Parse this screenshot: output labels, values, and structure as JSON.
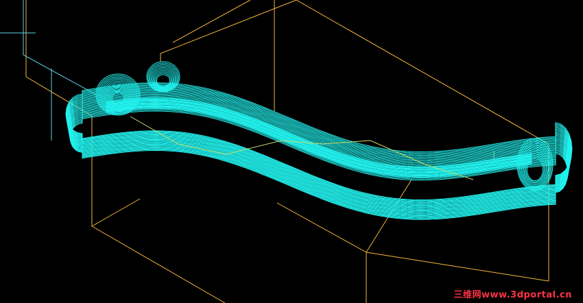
{
  "viewport": {
    "background": "#000000",
    "stock_box_color": "#f5b83c",
    "toolpath_color": "#22f2ee",
    "tool_axis_color": "#5fd6e6",
    "surface_color": "#c9e06a"
  },
  "watermark": {
    "text": "三维网www.3dportal.cn",
    "color": "#ff3344"
  }
}
